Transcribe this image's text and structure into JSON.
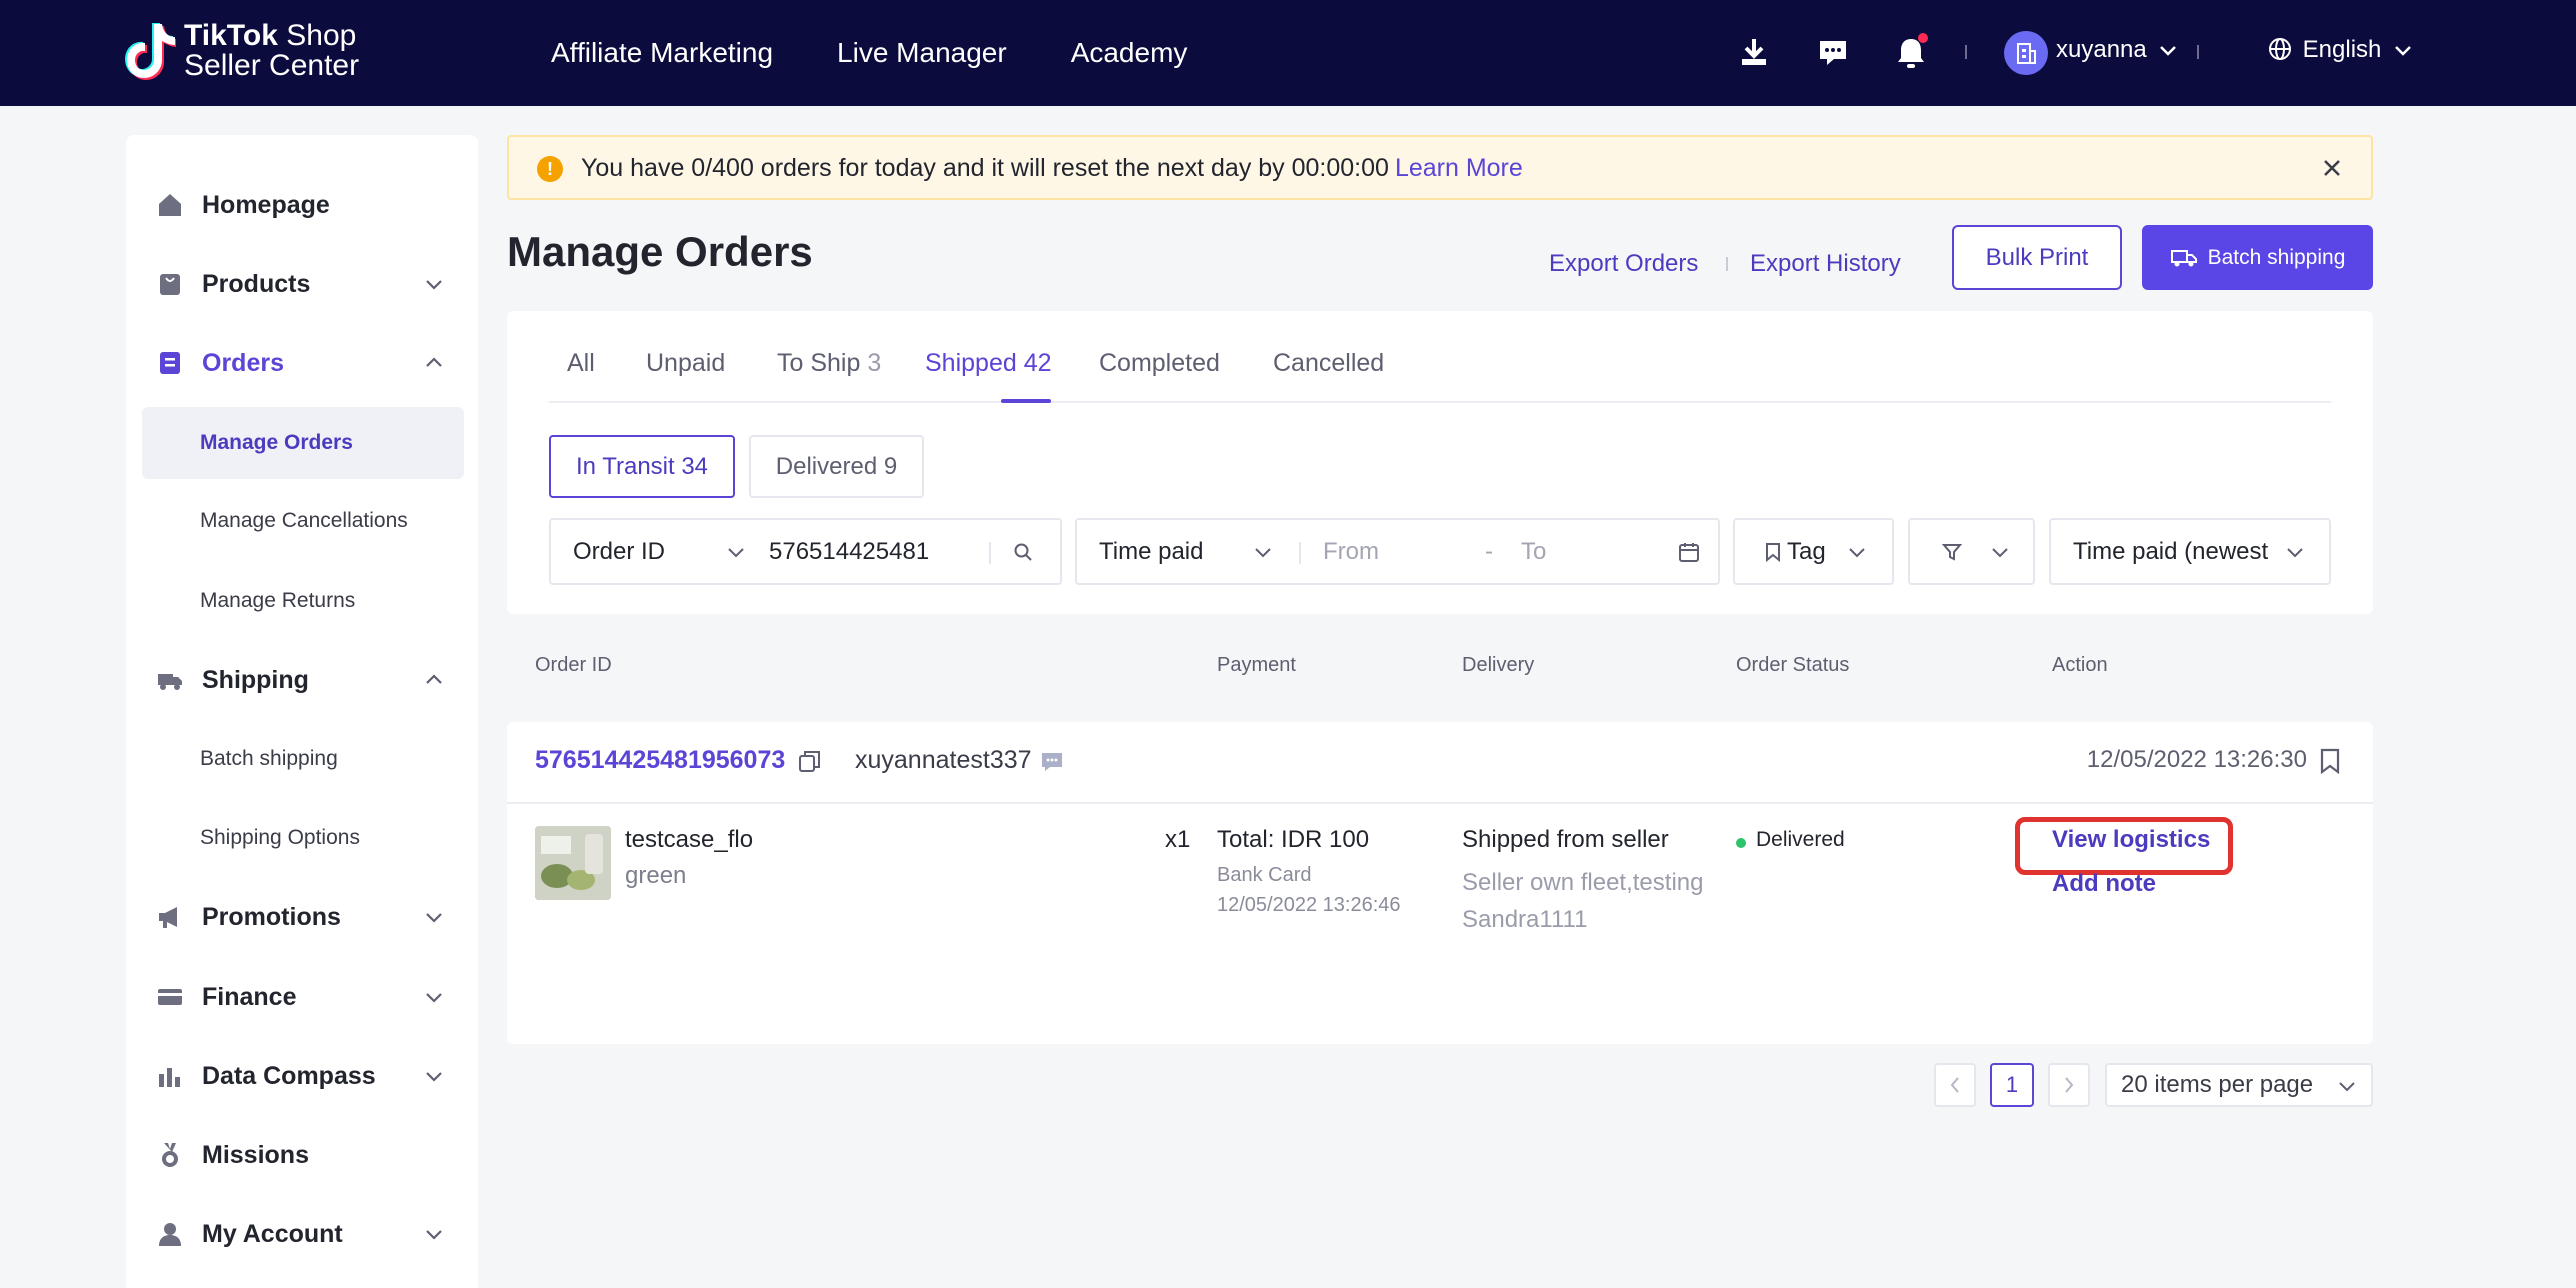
{
  "topbar": {
    "logo_line1_bold": "TikTok",
    "logo_line1_rest": " Shop",
    "logo_line2": "Seller Center",
    "nav": [
      "Affiliate Marketing",
      "Live Manager",
      "Academy"
    ],
    "username": "xuyanna",
    "language": "English",
    "icons": [
      "download-icon",
      "message-icon",
      "bell-icon",
      "globe-icon"
    ]
  },
  "sidebar": {
    "items": [
      {
        "label": "Homepage",
        "icon": "home-icon"
      },
      {
        "label": "Products",
        "icon": "bag-icon"
      },
      {
        "label": "Orders",
        "icon": "orders-icon"
      },
      {
        "label": "Shipping",
        "icon": "truck-icon"
      },
      {
        "label": "Promotions",
        "icon": "megaphone-icon"
      },
      {
        "label": "Finance",
        "icon": "card-icon"
      },
      {
        "label": "Data Compass",
        "icon": "chart-icon"
      },
      {
        "label": "Missions",
        "icon": "medal-icon"
      },
      {
        "label": "My Account",
        "icon": "user-icon"
      }
    ],
    "orders_sub": [
      "Manage Orders",
      "Manage Cancellations",
      "Manage Returns"
    ],
    "shipping_sub": [
      "Batch shipping",
      "Shipping Options"
    ]
  },
  "banner": {
    "text": "You have 0/400 orders for today and it will reset the next day by 00:00:00",
    "link": "Learn More"
  },
  "header": {
    "title": "Manage Orders",
    "export_orders": "Export Orders",
    "export_history": "Export History",
    "bulk_print": "Bulk Print",
    "batch_shipping": "Batch shipping"
  },
  "tabs": [
    {
      "label": "All",
      "count": ""
    },
    {
      "label": "Unpaid",
      "count": ""
    },
    {
      "label": "To Ship",
      "count": "3"
    },
    {
      "label": "Shipped",
      "count": "42"
    },
    {
      "label": "Completed",
      "count": ""
    },
    {
      "label": "Cancelled",
      "count": ""
    }
  ],
  "subtabs": {
    "in_transit": "In Transit 34",
    "delivered": "Delivered 9"
  },
  "filters": {
    "search_type": "Order ID",
    "search_value": "576514425481",
    "time_type": "Time paid",
    "from_placeholder": "From",
    "dash": "-",
    "to_placeholder": "To",
    "tag": "Tag",
    "sort": "Time paid (newest"
  },
  "table": {
    "columns": [
      "Order ID",
      "Payment",
      "Delivery",
      "Order Status",
      "Action"
    ],
    "order": {
      "id": "576514425481956073",
      "buyer": "xuyannatest337",
      "date": "12/05/2022 13:26:30",
      "product_name": "testcase_flo",
      "variant": "green",
      "qty": "x1",
      "total": "Total: IDR 100",
      "pay_method": "Bank Card",
      "pay_time": "12/05/2022 13:26:46",
      "delivery": "Shipped from seller",
      "carrier": "Seller own fleet,testing Sandra1111",
      "status": "Delivered",
      "action_primary": "View logistics",
      "action_secondary": "Add note"
    }
  },
  "pagination": {
    "page": "1",
    "per_page": "20 items per page"
  },
  "colors": {
    "brand": "#5a45d6",
    "topbar": "#0b0b3d",
    "highlight": "#e0322e",
    "status_ok": "#2ec26b"
  }
}
